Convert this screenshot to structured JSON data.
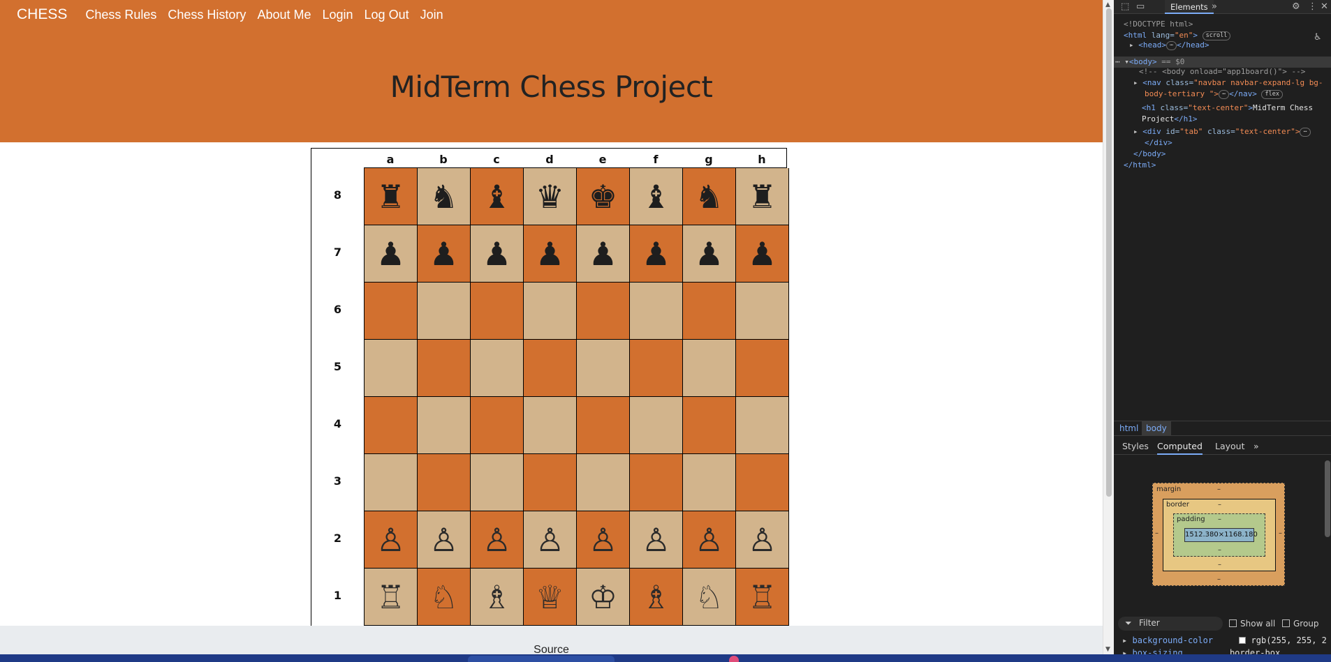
{
  "navbar": {
    "brand": "CHESS",
    "links": [
      "Chess Rules",
      "Chess History",
      "About Me",
      "Login",
      "Log Out",
      "Join"
    ]
  },
  "page": {
    "title": "MidTerm Chess Project",
    "footer": "Source"
  },
  "board": {
    "files": [
      "a",
      "b",
      "c",
      "d",
      "e",
      "f",
      "g",
      "h"
    ],
    "ranks": [
      "8",
      "7",
      "6",
      "5",
      "4",
      "3",
      "2",
      "1"
    ],
    "pieces": {
      "8": [
        "♜",
        "♞",
        "♝",
        "♛",
        "♚",
        "♝",
        "♞",
        "♜"
      ],
      "7": [
        "♟",
        "♟",
        "♟",
        "♟",
        "♟",
        "♟",
        "♟",
        "♟"
      ],
      "6": [
        "",
        "",
        "",
        "",
        "",
        "",
        "",
        ""
      ],
      "5": [
        "",
        "",
        "",
        "",
        "",
        "",
        "",
        ""
      ],
      "4": [
        "",
        "",
        "",
        "",
        "",
        "",
        "",
        ""
      ],
      "3": [
        "",
        "",
        "",
        "",
        "",
        "",
        "",
        ""
      ],
      "2": [
        "♙",
        "♙",
        "♙",
        "♙",
        "♙",
        "♙",
        "♙",
        "♙"
      ],
      "1": [
        "♖",
        "♘",
        "♗",
        "♕",
        "♔",
        "♗",
        "♘",
        "♖"
      ]
    },
    "colors": {
      "dark": "#d2702f",
      "light": "#d2b48c"
    }
  },
  "devtools": {
    "tab_active": "Elements",
    "dom_lines": {
      "doctype": "<!DOCTYPE html>",
      "html_open_tag": "<html",
      "html_lang_attr": "lang=",
      "html_lang_val": "\"en\"",
      "html_close_bracket": ">",
      "scroll_pill": "scroll",
      "head_line": "<head>",
      "head_close": "</head>",
      "ellipsis_pill": "⋯",
      "body_line": "<body>",
      "body_eq": " == $0",
      "comment": "<!-- <body onload=\"app1board()\"> -->",
      "nav_open": "<nav",
      "nav_class_attr": "class=",
      "nav_class_val": "\"navbar navbar-expand-lg bg-",
      "nav_class_val2": "body-tertiary \">",
      "nav_close": "</nav>",
      "flex_pill": "flex",
      "h1_open": "<h1",
      "h1_class_attr": "class=",
      "h1_class_val": "\"text-center\"",
      "h1_text": "MidTerm Chess",
      "h1_text2": "Project",
      "h1_close": "</h1>",
      "div_open": "<div",
      "div_id_attr": "id=",
      "div_id_val": "\"tab\"",
      "div_class_attr": "class=",
      "div_class_val": "\"text-center\">",
      "div_close": "</div>",
      "body_close": "</body>",
      "html_close": "</html>"
    },
    "breadcrumbs": [
      "html",
      "body"
    ],
    "subtabs": [
      "Styles",
      "Computed",
      "Layout"
    ],
    "subtab_active": "Computed",
    "box_model": {
      "margin_label": "margin",
      "border_label": "border",
      "padding_label": "padding",
      "content": "1512.380×1168.180",
      "dash": "–"
    },
    "filter_placeholder": "Filter",
    "show_all": "Show all",
    "group": "Group",
    "prop1_name": "background-color",
    "prop1_value": "rgb(255, 255, 2",
    "prop2_name": "box-sizing",
    "prop2_value": "border-box"
  }
}
